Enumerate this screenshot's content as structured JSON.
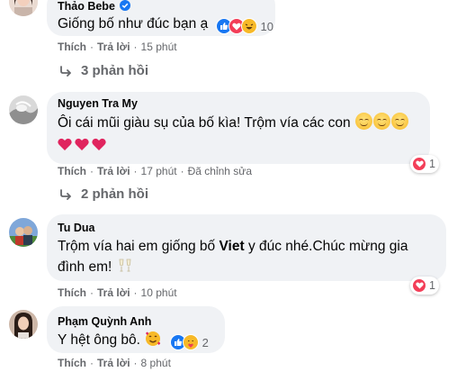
{
  "comments": [
    {
      "name": "Thảo Bebe",
      "text": "Giống bố như đúc bạn ạ",
      "reaction_count": "10",
      "like": "Thích",
      "reply": "Trả lời",
      "time": "15 phút",
      "replies": "3 phản hồi",
      "verified_color": "#1877f2"
    },
    {
      "name": "Nguyen Tra My",
      "text_line1": "Ôi cái mũi giàu sụ của bố kìa! Trộm vía các con",
      "hearts": 3,
      "reaction_count": "1",
      "like": "Thích",
      "reply": "Trả lời",
      "time": "17 phút",
      "edited": "Đã chỉnh sửa",
      "replies": "2 phản hồi"
    },
    {
      "name": "Tu Dua",
      "text_line1_a": "Trộm vía hai em giống bố ",
      "text_line1_bold": "Viet",
      "text_line1_b": " y đúc nhé.Chúc mừng gia",
      "text_line2": "đình em!",
      "reaction_count": "1",
      "like": "Thích",
      "reply": "Trả lời",
      "time": "10 phút"
    },
    {
      "name": "Phạm Quỳnh Anh",
      "text": "Y hệt ông bô.",
      "reaction_count": "2",
      "like": "Thích",
      "reply": "Trả lời",
      "time": "8 phút"
    }
  ],
  "colors": {
    "bubble": "#f0f2f5",
    "meta_text": "#65676b",
    "like_blue": "#1877f2",
    "love_red": "#f33e58",
    "haha_yellow": "#f7b928"
  }
}
